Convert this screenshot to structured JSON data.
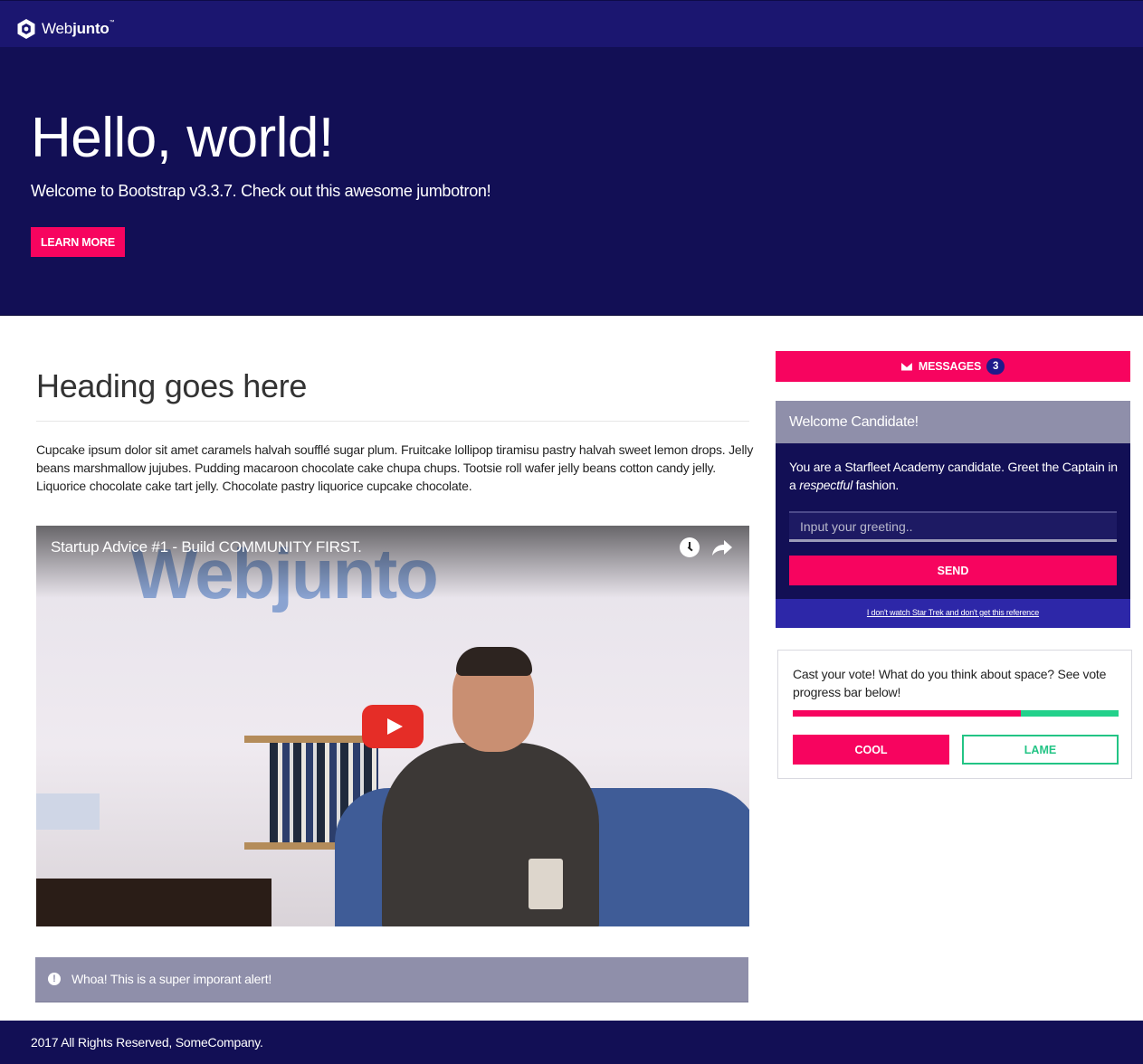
{
  "navbar": {
    "brand_regular": "Web",
    "brand_bold": "junto",
    "brand_tm": "™"
  },
  "jumbotron": {
    "title": "Hello, world!",
    "subtitle": "Welcome to Bootstrap v3.3.7. Check out this awesome jumbotron!",
    "button_label": "LEARN MORE"
  },
  "main": {
    "heading": "Heading goes here",
    "paragraph": "Cupcake ipsum dolor sit amet caramels halvah soufflé sugar plum. Fruitcake lollipop tiramisu pastry halvah sweet lemon drops. Jelly beans marshmallow jujubes. Pudding macaroon chocolate cake chupa chups. Tootsie roll wafer jelly beans cotton candy jelly. Liquorice chocolate cake tart jelly. Chocolate pastry liquorice cupcake chocolate.",
    "video": {
      "title": "Startup Advice #1 - Build COMMUNITY FIRST.",
      "watermark_regular": "Web",
      "watermark_bold": "junto"
    },
    "alert": {
      "text": "Whoa! This is a super imporant alert!",
      "icon": "exclamation-circle-icon"
    }
  },
  "sidebar": {
    "messages": {
      "label": "MESSAGES",
      "count": "3",
      "icon": "envelope-icon"
    },
    "candidate_panel": {
      "title": "Welcome Candidate!",
      "text_before": "You are a Starfleet Academy candidate. Greet the Captain in a ",
      "text_emphasis": "respectful",
      "text_after": " fashion.",
      "input_placeholder": "Input your greeting..",
      "input_value": "",
      "send_label": "SEND",
      "footer_link": "I don't watch Star Trek and don't get this reference"
    },
    "vote": {
      "text": "Cast your vote! What do you think about space? See vote progress bar below!",
      "cool_fraction": 0.7,
      "cool_label": "COOL",
      "lame_label": "LAME"
    }
  },
  "footer": {
    "text": "2017 All Rights Reserved, SomeCompany."
  },
  "colors": {
    "navbar": "#1b1670",
    "jumbotron": "#120f55",
    "accent_pink": "#f7045f",
    "accent_green": "#23d18b",
    "panel_gray": "#8f8faa",
    "link_bar": "#2d27a8"
  }
}
